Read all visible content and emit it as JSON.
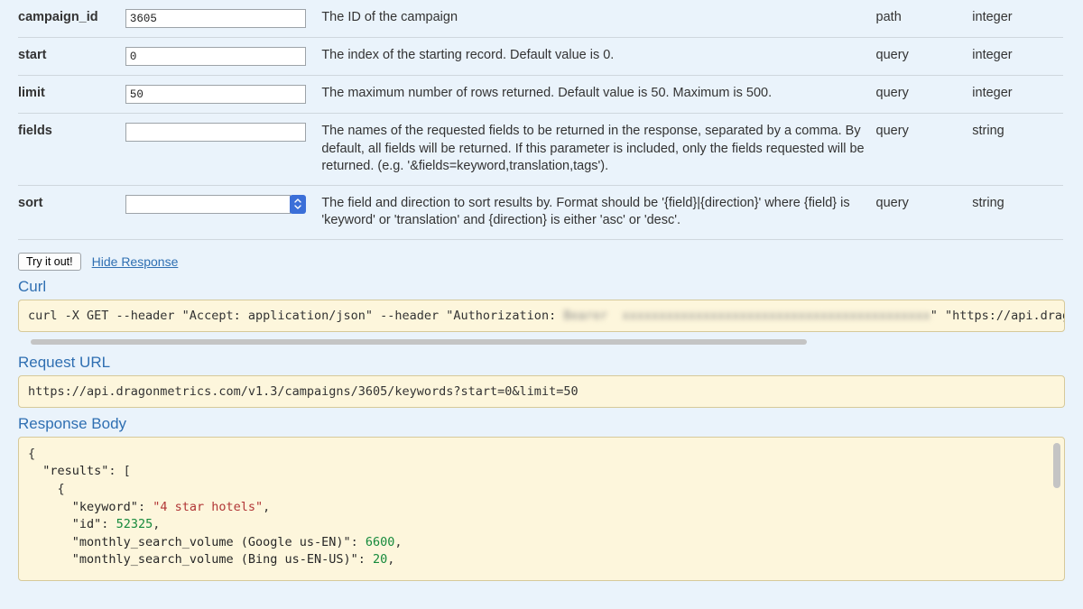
{
  "params": [
    {
      "name": "campaign_id",
      "value": "3605",
      "description": "The ID of the campaign",
      "in": "path",
      "type": "integer",
      "control": "text"
    },
    {
      "name": "start",
      "value": "0",
      "description": "The index of the starting record. Default value is 0.",
      "in": "query",
      "type": "integer",
      "control": "text"
    },
    {
      "name": "limit",
      "value": "50",
      "description": "The maximum number of rows returned. Default value is 50. Maximum is 500.",
      "in": "query",
      "type": "integer",
      "control": "text"
    },
    {
      "name": "fields",
      "value": "",
      "description": "The names of the requested fields to be returned in the response, separated by a comma. By default, all fields will be returned. If this parameter is included, only the fields requested will be returned. (e.g. '&fields=keyword,translation,tags').",
      "in": "query",
      "type": "string",
      "control": "text"
    },
    {
      "name": "sort",
      "value": "",
      "description": "The field and direction to sort results by. Format should be '{field}|{direction}' where {field} is 'keyword' or 'translation' and {direction} is either 'asc' or 'desc'.",
      "in": "query",
      "type": "string",
      "control": "select"
    }
  ],
  "actions": {
    "try_label": "Try it out!",
    "hide_label": "Hide Response"
  },
  "sections": {
    "curl_heading": "Curl",
    "request_url_heading": "Request URL",
    "response_body_heading": "Response Body"
  },
  "curl": {
    "prefix": "curl -X GET --header \"Accept: application/json\" --header \"Authorization:",
    "blurred": "Bearer  xxxxxxxxxxxxxxxxxxxxxxxxxxxxxxxxxxxxxxxxxx",
    "suffix": "\" \"https://api.dragonmetrics.com/v"
  },
  "request_url": "https://api.dragonmetrics.com/v1.3/campaigns/3605/keywords?start=0&limit=50",
  "response_body": {
    "line0": "{",
    "line1_key": "\"results\"",
    "line1_rest": ": [",
    "line2": "    {",
    "kw_key": "\"keyword\"",
    "kw_val": "\"4 star hotels\"",
    "id_key": "\"id\"",
    "id_val": "52325",
    "msv_g_key": "\"monthly_search_volume (Google us-EN)\"",
    "msv_g_val": "6600",
    "msv_b_key": "\"monthly_search_volume (Bing us-EN-US)\"",
    "msv_b_val": "20"
  }
}
